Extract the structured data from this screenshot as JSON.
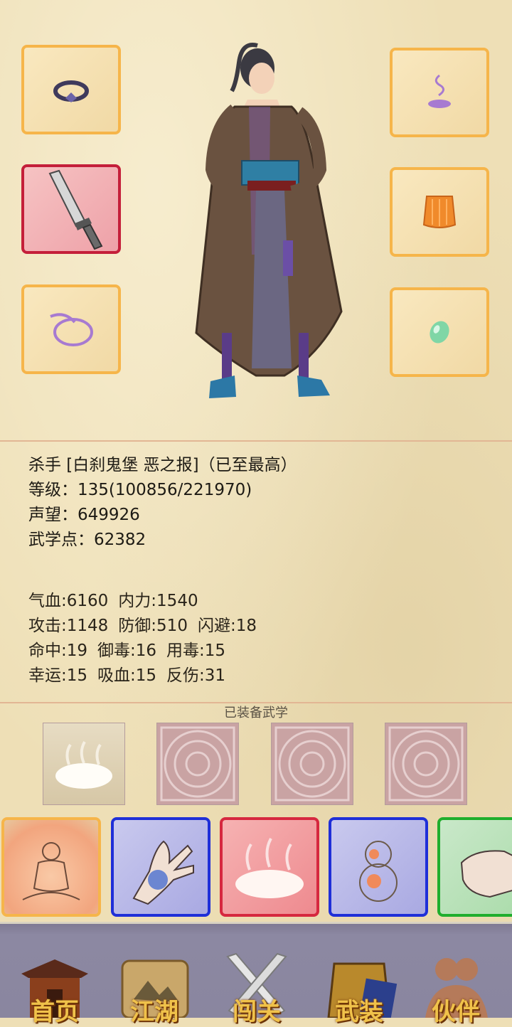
{
  "equipment": {
    "left_slots": [
      {
        "name": "ring-icon",
        "accent": "#6b63a8"
      },
      {
        "name": "sword-icon",
        "accent": "#8a8a8a"
      },
      {
        "name": "amulet-icon",
        "accent": "#a77ad1"
      }
    ],
    "right_slots": [
      {
        "name": "incense-icon",
        "accent": "#a77ad1"
      },
      {
        "name": "vest-icon",
        "accent": "#f08a2b"
      },
      {
        "name": "jade-icon",
        "accent": "#6fc99a"
      }
    ]
  },
  "character": {
    "title_line": "杀手 [白刹鬼堡 恶之报]（已至最高）",
    "level_line": "等级：135(100856/221970)",
    "reputation_line": "声望：649926",
    "martial_points_line": "武学点：62382"
  },
  "stats": {
    "row1": [
      "气血:6160",
      "内力:1540"
    ],
    "row2": [
      "攻击:1148",
      "防御:510",
      "闪避:18"
    ],
    "row3": [
      "命中:19",
      "御毒:16",
      "用毒:15"
    ],
    "row4": [
      "幸运:15",
      "吸血:15",
      "反伤:31"
    ]
  },
  "equipped_martial": {
    "title": "已装备武学"
  },
  "skills": [
    {
      "icon": "meditation-icon",
      "border": "#f6b54a"
    },
    {
      "icon": "palm-icon",
      "border": "#1f2fd8"
    },
    {
      "icon": "steam-icon",
      "border": "#d6283f"
    },
    {
      "icon": "gourd-icon",
      "border": "#1f2fd8"
    },
    {
      "icon": "fist-icon",
      "border": "#1fae2d"
    }
  ],
  "nav": [
    {
      "label": "首页",
      "icon": "house-icon"
    },
    {
      "label": "江湖",
      "icon": "scroll-icon"
    },
    {
      "label": "闯关",
      "icon": "crossed-swords-icon"
    },
    {
      "label": "武装",
      "icon": "armor-icon"
    },
    {
      "label": "伙伴",
      "icon": "partners-icon"
    }
  ]
}
